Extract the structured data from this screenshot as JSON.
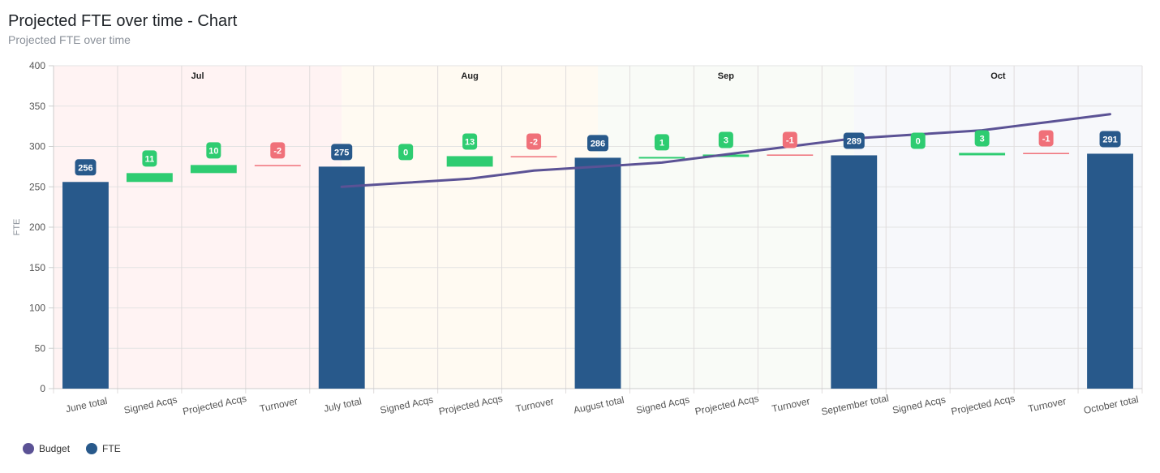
{
  "header": {
    "title": "Projected FTE over time - Chart",
    "subtitle": "Projected FTE over time"
  },
  "colors": {
    "fte": "#28598b",
    "budget": "#5b5295",
    "increase": "#2ecc71",
    "decrease": "#f07079",
    "band_jul": "#fff3f3",
    "band_aug": "#fffaf2",
    "band_sep": "#f9fbf7",
    "band_oct": "#f7f8fb"
  },
  "legend": [
    {
      "label": "Budget",
      "color": "#5b5295"
    },
    {
      "label": "FTE",
      "color": "#28598b"
    }
  ],
  "chart_data": {
    "type": "bar",
    "subtype": "waterfall-with-line",
    "title": "Projected FTE over time - Chart",
    "subtitle": "Projected FTE over time",
    "xlabel": "",
    "ylabel": "FTE",
    "ylim": [
      0,
      400
    ],
    "yticks": [
      0,
      50,
      100,
      150,
      200,
      250,
      300,
      350,
      400
    ],
    "grid": true,
    "legend_position": "bottom-left",
    "categories": [
      "June total",
      "Signed Acqs",
      "Projected Acqs",
      "Turnover",
      "July total",
      "Signed Acqs",
      "Projected Acqs",
      "Turnover",
      "August total",
      "Signed Acqs",
      "Projected Acqs",
      "Turnover",
      "September total",
      "Signed Acqs",
      "Projected Acqs",
      "Turnover",
      "October total"
    ],
    "month_bands": [
      {
        "label": "Jul",
        "from_index": 0,
        "to_index": 4
      },
      {
        "label": "Aug",
        "from_index": 4,
        "to_index": 8
      },
      {
        "label": "Sep",
        "from_index": 8,
        "to_index": 12
      },
      {
        "label": "Oct",
        "from_index": 12,
        "to_index": 16
      }
    ],
    "series": [
      {
        "name": "FTE",
        "type": "waterfall",
        "bars": [
          {
            "kind": "total",
            "from": 0,
            "to": 256,
            "label": "256"
          },
          {
            "kind": "increase",
            "from": 256,
            "to": 267,
            "label": "11"
          },
          {
            "kind": "increase",
            "from": 267,
            "to": 277,
            "label": "10"
          },
          {
            "kind": "decrease",
            "from": 277,
            "to": 275,
            "label": "-2"
          },
          {
            "kind": "total",
            "from": 0,
            "to": 275,
            "label": "275"
          },
          {
            "kind": "increase",
            "from": 275,
            "to": 275,
            "label": "0"
          },
          {
            "kind": "increase",
            "from": 275,
            "to": 288,
            "label": "13"
          },
          {
            "kind": "decrease",
            "from": 288,
            "to": 286,
            "label": "-2"
          },
          {
            "kind": "total",
            "from": 0,
            "to": 286,
            "label": "286"
          },
          {
            "kind": "increase",
            "from": 286,
            "to": 287,
            "label": "1"
          },
          {
            "kind": "increase",
            "from": 287,
            "to": 290,
            "label": "3"
          },
          {
            "kind": "decrease",
            "from": 290,
            "to": 289,
            "label": "-1"
          },
          {
            "kind": "total",
            "from": 0,
            "to": 289,
            "label": "289"
          },
          {
            "kind": "increase",
            "from": 289,
            "to": 289,
            "label": "0"
          },
          {
            "kind": "increase",
            "from": 289,
            "to": 292,
            "label": "3"
          },
          {
            "kind": "decrease",
            "from": 292,
            "to": 291,
            "label": "-1"
          },
          {
            "kind": "total",
            "from": 0,
            "to": 291,
            "label": "291"
          }
        ]
      },
      {
        "name": "Budget",
        "type": "line",
        "values": [
          null,
          null,
          null,
          null,
          250,
          255,
          260,
          270,
          275,
          280,
          290,
          300,
          310,
          315,
          320,
          330,
          340
        ]
      }
    ]
  }
}
